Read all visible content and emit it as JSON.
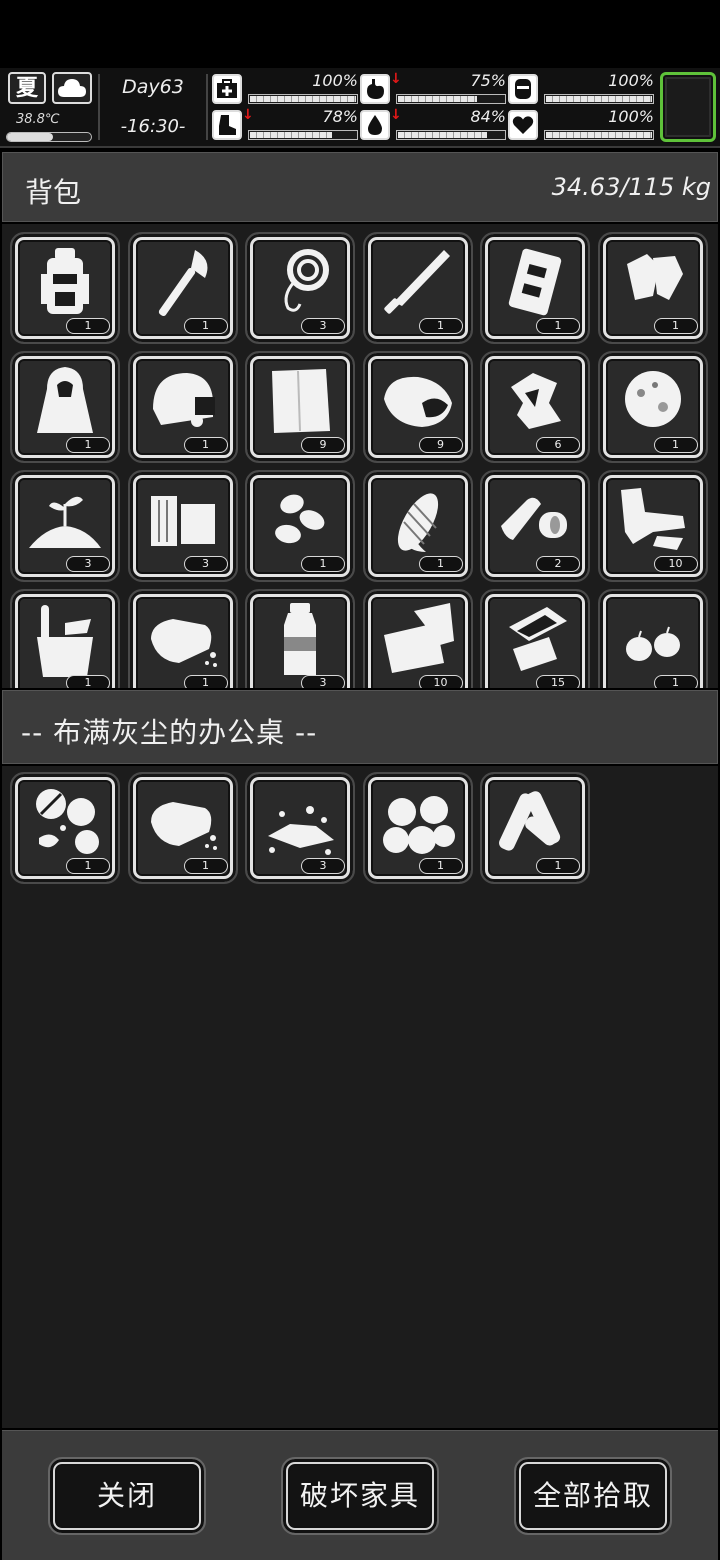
{
  "hud": {
    "season": "夏",
    "weather_icon": "cloud-icon",
    "temperature": "38.8℃",
    "temperature_level": 0.55,
    "day": "Day63",
    "time": "-16:30-",
    "stats": [
      {
        "id": "health",
        "icon": "medkit-icon",
        "percent_label": "100%",
        "value": 1.0,
        "decreasing": false
      },
      {
        "id": "hunger",
        "icon": "stomach-icon",
        "percent_label": "75%",
        "value": 0.75,
        "decreasing": true
      },
      {
        "id": "armor",
        "icon": "armor-icon",
        "percent_label": "100%",
        "value": 1.0,
        "decreasing": false
      },
      {
        "id": "stamina",
        "icon": "boot-icon",
        "percent_label": "78%",
        "value": 0.78,
        "decreasing": true
      },
      {
        "id": "thirst",
        "icon": "water-drop-icon",
        "percent_label": "84%",
        "value": 0.84,
        "decreasing": true
      },
      {
        "id": "mood",
        "icon": "heart-icon",
        "percent_label": "100%",
        "value": 1.0,
        "decreasing": false
      }
    ],
    "selected_slot_color": "#5fc23a"
  },
  "backpack": {
    "title": "背包",
    "weight": "34.63/115 kg",
    "items": [
      {
        "name": "backpack",
        "qty": "1"
      },
      {
        "name": "axe",
        "qty": "1"
      },
      {
        "name": "rope",
        "qty": "3"
      },
      {
        "name": "machete",
        "qty": "1"
      },
      {
        "name": "vest",
        "qty": "1"
      },
      {
        "name": "gloves",
        "qty": "1"
      },
      {
        "name": "raincoat",
        "qty": "1"
      },
      {
        "name": "helmet",
        "qty": "1"
      },
      {
        "name": "cloth",
        "qty": "9"
      },
      {
        "name": "sweet-potato",
        "qty": "9"
      },
      {
        "name": "scrap",
        "qty": "6"
      },
      {
        "name": "fiber",
        "qty": "1"
      },
      {
        "name": "seedling-soil",
        "qty": "3"
      },
      {
        "name": "wood",
        "qty": "3"
      },
      {
        "name": "seeds",
        "qty": "1"
      },
      {
        "name": "corn",
        "qty": "1"
      },
      {
        "name": "bandage",
        "qty": "2"
      },
      {
        "name": "leather-scraps",
        "qty": "10"
      },
      {
        "name": "bucket",
        "qty": "1"
      },
      {
        "name": "bread",
        "qty": "1"
      },
      {
        "name": "water-bottle",
        "qty": "3"
      },
      {
        "name": "paper",
        "qty": "10"
      },
      {
        "name": "metal-sheets",
        "qty": "15"
      },
      {
        "name": "nuts",
        "qty": "1"
      }
    ]
  },
  "location": {
    "title": "-- 布满灰尘的办公桌 --",
    "items": [
      {
        "name": "pills",
        "qty": "1"
      },
      {
        "name": "bread",
        "qty": "1"
      },
      {
        "name": "crumbs",
        "qty": "3"
      },
      {
        "name": "chestnuts",
        "qty": "1"
      },
      {
        "name": "scrolls",
        "qty": "1"
      }
    ]
  },
  "buttons": {
    "close": "关闭",
    "destroy_furniture": "破坏家具",
    "take_all": "全部拾取"
  }
}
